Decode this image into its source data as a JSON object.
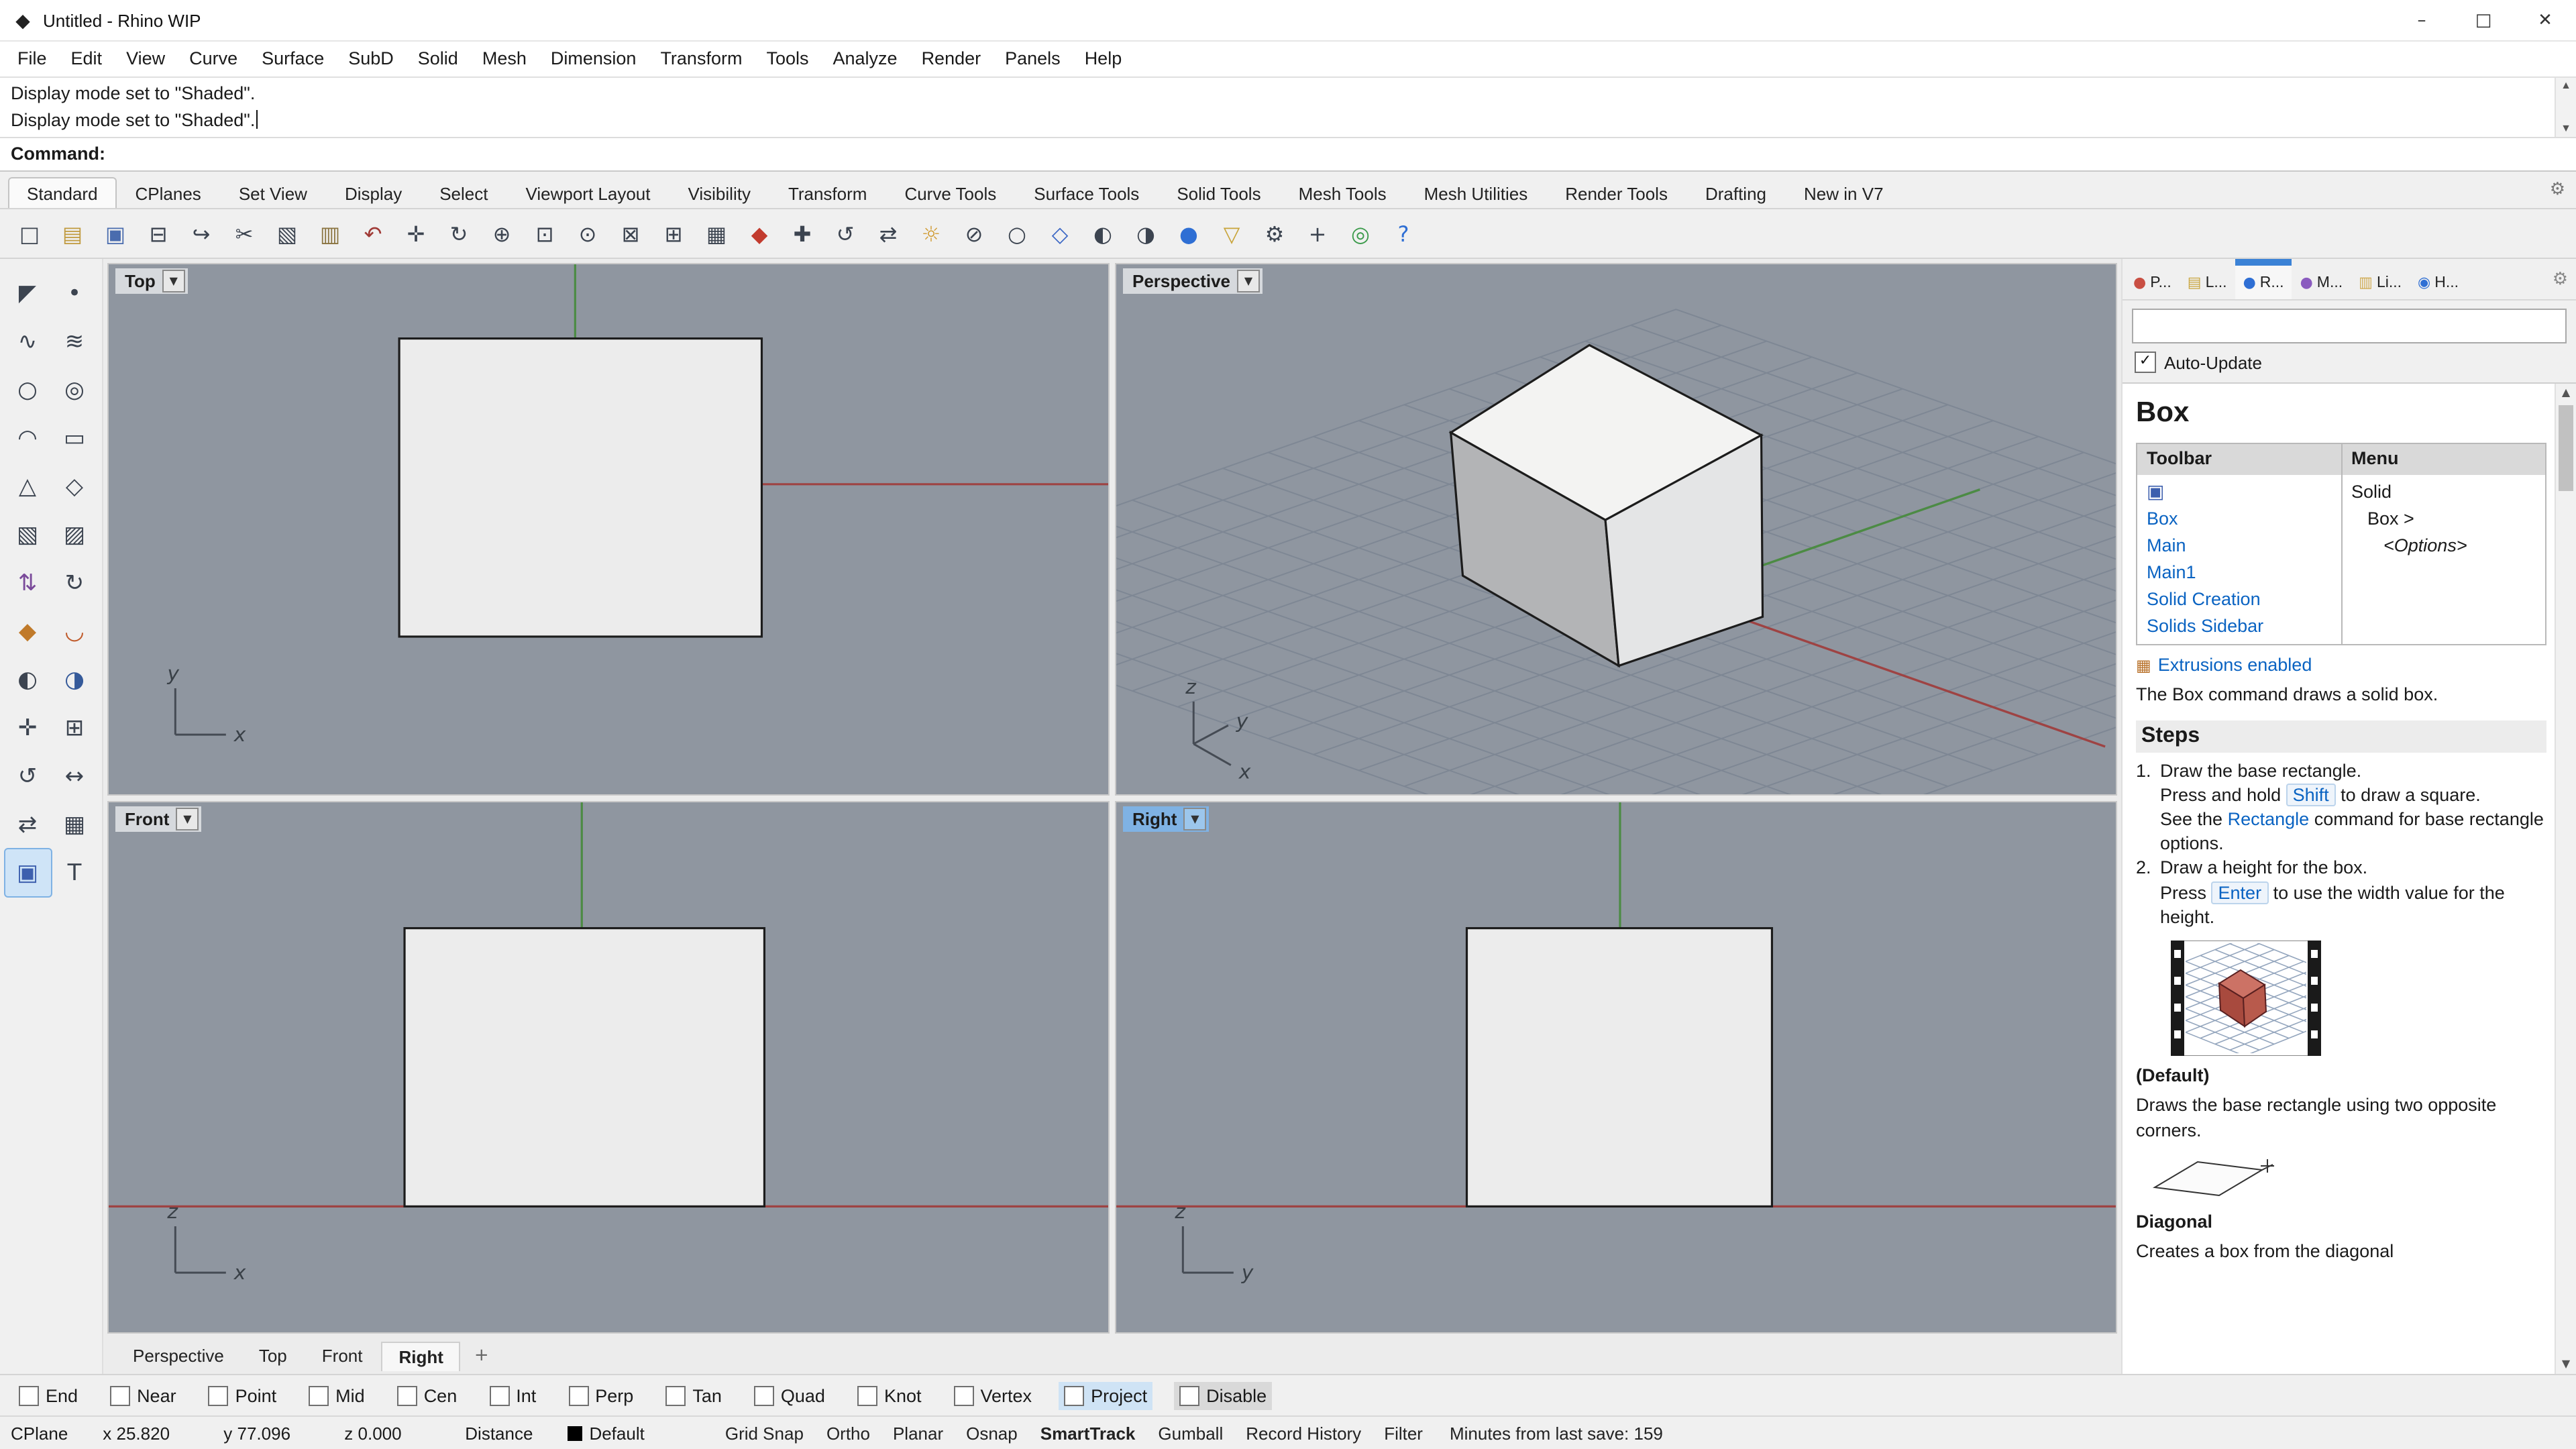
{
  "window": {
    "title": "Untitled - Rhino WIP"
  },
  "icons": {
    "app": "◆",
    "minimize": "–",
    "maximize": "□",
    "close": "✕",
    "dropdown": "▼",
    "check": "✓",
    "plus": "+",
    "gear": "⚙",
    "scroll_up": "▲",
    "scroll_down": "▼",
    "box_tool": "▣",
    "extrusions": "▦"
  },
  "menu_bar": {
    "items": [
      "File",
      "Edit",
      "View",
      "Curve",
      "Surface",
      "SubD",
      "Solid",
      "Mesh",
      "Dimension",
      "Transform",
      "Tools",
      "Analyze",
      "Render",
      "Panels",
      "Help"
    ]
  },
  "command_area": {
    "history": [
      "Display mode set to \"Shaded\".",
      "Display mode set to \"Shaded\"."
    ],
    "prompt": "Command:"
  },
  "toolbar_tabs": {
    "active": "Standard",
    "items": [
      "Standard",
      "CPlanes",
      "Set View",
      "Display",
      "Select",
      "Viewport Layout",
      "Visibility",
      "Transform",
      "Curve Tools",
      "Surface Tools",
      "Solid Tools",
      "Mesh Tools",
      "Mesh Utilities",
      "Render Tools",
      "Drafting",
      "New in V7"
    ]
  },
  "toolbar_icons": [
    {
      "name": "new-file",
      "glyph": "□"
    },
    {
      "name": "open-file",
      "glyph": "▤",
      "color": "#c09a3e"
    },
    {
      "name": "save",
      "glyph": "▣",
      "color": "#4a6cae"
    },
    {
      "name": "print",
      "glyph": "⊟"
    },
    {
      "name": "export",
      "glyph": "↪"
    },
    {
      "name": "cut",
      "glyph": "✂"
    },
    {
      "name": "copy",
      "glyph": "▧"
    },
    {
      "name": "paste",
      "glyph": "▥",
      "color": "#8a7440"
    },
    {
      "name": "undo",
      "glyph": "↶",
      "color": "#a03a36"
    },
    {
      "name": "pan",
      "glyph": "✛"
    },
    {
      "name": "rotate-view",
      "glyph": "↻"
    },
    {
      "name": "zoom-dynamic",
      "glyph": "⊕"
    },
    {
      "name": "zoom-window",
      "glyph": "⊡"
    },
    {
      "name": "zoom-selected",
      "glyph": "⊙"
    },
    {
      "name": "zoom-extents",
      "glyph": "⊠"
    },
    {
      "name": "zoom-extents-all",
      "glyph": "⊞"
    },
    {
      "name": "viewport-layout",
      "glyph": "▦"
    },
    {
      "name": "render",
      "glyph": "◆",
      "color": "#c23b2e"
    },
    {
      "name": "move",
      "glyph": "✚"
    },
    {
      "name": "rotate",
      "glyph": "↺"
    },
    {
      "name": "scale",
      "glyph": "⇄"
    },
    {
      "name": "lights",
      "glyph": "☼",
      "color": "#d09a30"
    },
    {
      "name": "lock-objects",
      "glyph": "⊘"
    },
    {
      "name": "hide-objects",
      "glyph": "○"
    },
    {
      "name": "display-wireframe",
      "glyph": "◇",
      "color": "#3a66c4"
    },
    {
      "name": "display-shaded",
      "glyph": "◐"
    },
    {
      "name": "display-ghosted",
      "glyph": "◑"
    },
    {
      "name": "display-rendered",
      "glyph": "●",
      "color": "#2f6fd4"
    },
    {
      "name": "selection-filter",
      "glyph": "▽",
      "color": "#c8a43a"
    },
    {
      "name": "options",
      "glyph": "⚙"
    },
    {
      "name": "cplane-tools",
      "glyph": "+"
    },
    {
      "name": "web-browser",
      "glyph": "◎",
      "color": "#3a9a4a"
    },
    {
      "name": "help",
      "glyph": "?",
      "color": "#2f6fd4"
    }
  ],
  "sidebar_tools": [
    {
      "name": "select",
      "glyph": "◤"
    },
    {
      "name": "point",
      "glyph": "•"
    },
    {
      "name": "curve",
      "glyph": "∿"
    },
    {
      "name": "curve-through-points",
      "glyph": "≋"
    },
    {
      "name": "circle",
      "glyph": "○"
    },
    {
      "name": "ellipse",
      "glyph": "◎"
    },
    {
      "name": "arc",
      "glyph": "◠"
    },
    {
      "name": "rectangle",
      "glyph": "▭"
    },
    {
      "name": "polyline",
      "glyph": "△"
    },
    {
      "name": "polygon",
      "glyph": "◇"
    },
    {
      "name": "surface",
      "glyph": "▧"
    },
    {
      "name": "loft",
      "glyph": "▨"
    },
    {
      "name": "extrude",
      "glyph": "⇅",
      "color": "#7a4a9a"
    },
    {
      "name": "revolve",
      "glyph": "↻"
    },
    {
      "name": "sweep",
      "glyph": "◆",
      "color": "#c07a2a"
    },
    {
      "name": "fillet",
      "glyph": "◡",
      "color": "#c05a2a"
    },
    {
      "name": "boolean-union",
      "glyph": "◐"
    },
    {
      "name": "boolean-difference",
      "glyph": "◑",
      "color": "#355a9a"
    },
    {
      "name": "move",
      "glyph": "✛"
    },
    {
      "name": "copy",
      "glyph": "⊞"
    },
    {
      "name": "rotate",
      "glyph": "↺"
    },
    {
      "name": "scale",
      "glyph": "↔"
    },
    {
      "name": "mirror",
      "glyph": "⇄"
    },
    {
      "name": "array",
      "glyph": "▦"
    },
    {
      "name": "solid-box",
      "glyph": "▣",
      "color": "#3d5fae",
      "active": true
    },
    {
      "name": "annotate-text",
      "glyph": "T"
    }
  ],
  "viewports": {
    "top": {
      "label": "Top",
      "axis": {
        "v": "y",
        "h": "x"
      }
    },
    "perspective": {
      "label": "Perspective",
      "axis": {
        "v": "z",
        "h": "y",
        "d": "x"
      }
    },
    "front": {
      "label": "Front",
      "axis": {
        "v": "z",
        "h": "x"
      }
    },
    "right": {
      "label": "Right",
      "axis": {
        "v": "z",
        "h": "y"
      },
      "active": true
    }
  },
  "viewport_tabs": {
    "active": "Right",
    "items": [
      "Perspective",
      "Top",
      "Front",
      "Right"
    ]
  },
  "panel": {
    "tabs": [
      {
        "label": "P...",
        "glyph": "●",
        "color": "#c94f43"
      },
      {
        "label": "L...",
        "glyph": "▤",
        "color": "#c9a53f"
      },
      {
        "label": "R...",
        "glyph": "●",
        "color": "#2f6fd4",
        "active": true
      },
      {
        "label": "M...",
        "glyph": "●",
        "color": "#8a5bbf"
      },
      {
        "label": "Li...",
        "glyph": "▥",
        "color": "#cfa94f"
      },
      {
        "label": "H...",
        "glyph": "◉",
        "color": "#2f6fd4"
      }
    ],
    "auto_update_label": "Auto-Update",
    "search_value": "",
    "help": {
      "title": "Box",
      "command_table": {
        "headers": [
          "Toolbar",
          "Menu"
        ],
        "toolbar_links": [
          "Box",
          "Main",
          "Main1",
          "Solid Creation",
          "Solids Sidebar"
        ],
        "menu_lines": [
          {
            "text": "Solid"
          },
          {
            "text": "Box >",
            "indent": 1
          },
          {
            "text": "<Options>",
            "indent": 2,
            "italic": true
          }
        ]
      },
      "extrusions_link": "Extrusions enabled",
      "description": "The Box command draws a solid box.",
      "steps_title": "Steps",
      "step1": {
        "num": "1.",
        "line1": "Draw the base rectangle.",
        "line2_pre": "Press and hold ",
        "line2_key": "Shift",
        "line2_post": " to draw a square.",
        "line3_pre": "See the ",
        "line3_link": "Rectangle",
        "line3_post": " command for base rectangle options."
      },
      "step2": {
        "num": "2.",
        "line1": "Draw a height for the box.",
        "line2_pre": "Press ",
        "line2_key": "Enter",
        "line2_post": " to use the width value for the height."
      },
      "default_label": "(Default)",
      "default_desc": "Draws the base rectangle using two opposite corners.",
      "diagonal_label": "Diagonal",
      "diagonal_desc": "Creates a box from the diagonal"
    }
  },
  "osnap": {
    "items": [
      {
        "label": "End"
      },
      {
        "label": "Near"
      },
      {
        "label": "Point"
      },
      {
        "label": "Mid"
      },
      {
        "label": "Cen"
      },
      {
        "label": "Int"
      },
      {
        "label": "Perp"
      },
      {
        "label": "Tan"
      },
      {
        "label": "Quad"
      },
      {
        "label": "Knot"
      },
      {
        "label": "Vertex"
      },
      {
        "label": "Project",
        "bg": "#cfe3f5"
      },
      {
        "label": "Disable",
        "bg": "#d9d9d9"
      }
    ]
  },
  "status_bar": {
    "cplane": "CPlane",
    "x": "x 25.820",
    "y": "y 77.096",
    "z": "z 0.000",
    "distance": "Distance",
    "layer": "Default",
    "toggles": [
      {
        "label": "Grid Snap"
      },
      {
        "label": "Ortho"
      },
      {
        "label": "Planar"
      },
      {
        "label": "Osnap"
      },
      {
        "label": "SmartTrack",
        "active": true
      },
      {
        "label": "Gumball"
      },
      {
        "label": "Record History"
      },
      {
        "label": "Filter"
      }
    ],
    "autosave": "Minutes from last save: 159"
  },
  "colors": {
    "viewport_bg": "#8f96a0",
    "axis_x_red": "#9e4343",
    "axis_y_green": "#4c8b44",
    "active_viewport_highlight": "#7fb2e4",
    "link_blue": "#0a63c2",
    "panel_tab_indicator": "#3b82d6"
  }
}
